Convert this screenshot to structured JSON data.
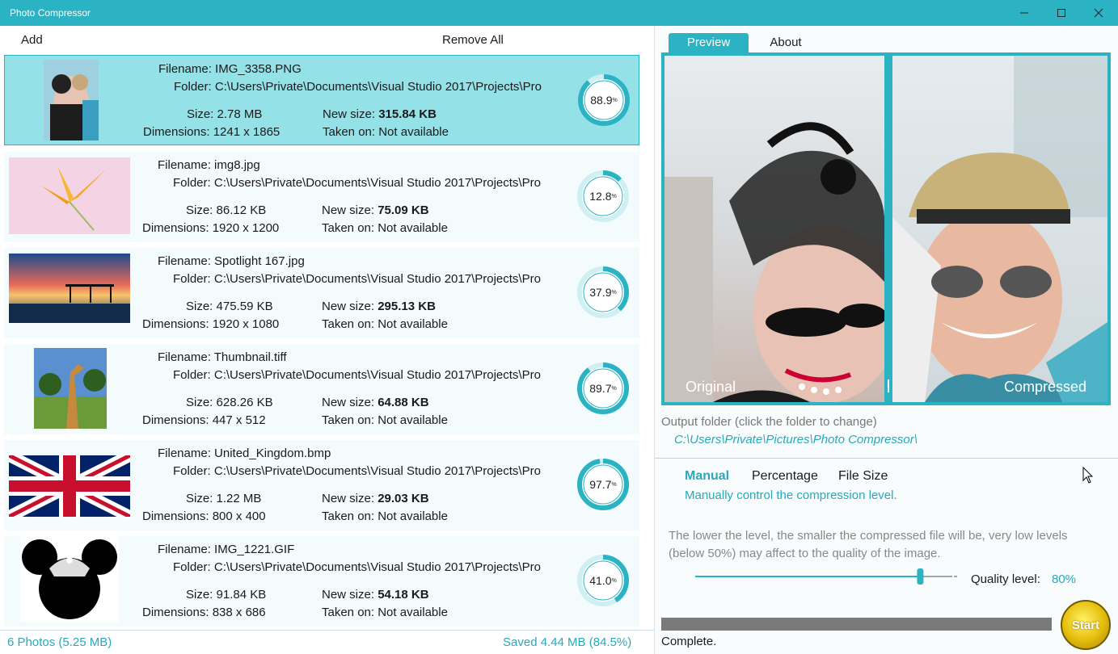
{
  "window": {
    "title": "Photo Compressor",
    "min_icon": "minimize-icon",
    "max_icon": "maximize-icon",
    "close_icon": "close-icon"
  },
  "toolbar": {
    "add": "Add",
    "remove_all": "Remove All"
  },
  "labels": {
    "filename": "Filename:",
    "folder": "Folder:",
    "size": "Size:",
    "new_size": "New size:",
    "dimensions": "Dimensions:",
    "taken_on": "Taken on:"
  },
  "photos": [
    {
      "filename": "IMG_3358.PNG",
      "folder": "C:\\Users\\Private\\Documents\\Visual Studio 2017\\Projects\\Pro",
      "size": "2.78 MB",
      "new_size": "315.84 KB",
      "dimensions": "1241 x 1865",
      "taken_on": "Not available",
      "ratio": "88.9",
      "ratio_value": 88.9
    },
    {
      "filename": "img8.jpg",
      "folder": "C:\\Users\\Private\\Documents\\Visual Studio 2017\\Projects\\Pro",
      "size": "86.12 KB",
      "new_size": "75.09 KB",
      "dimensions": "1920 x 1200",
      "taken_on": "Not available",
      "ratio": "12.8",
      "ratio_value": 12.8
    },
    {
      "filename": "Spotlight 167.jpg",
      "folder": "C:\\Users\\Private\\Documents\\Visual Studio 2017\\Projects\\Pro",
      "size": "475.59 KB",
      "new_size": "295.13 KB",
      "dimensions": "1920 x 1080",
      "taken_on": "Not available",
      "ratio": "37.9",
      "ratio_value": 37.9
    },
    {
      "filename": "Thumbnail.tiff",
      "folder": "C:\\Users\\Private\\Documents\\Visual Studio 2017\\Projects\\Pro",
      "size": "628.26 KB",
      "new_size": "64.88 KB",
      "dimensions": "447 x 512",
      "taken_on": "Not available",
      "ratio": "89.7",
      "ratio_value": 89.7
    },
    {
      "filename": "United_Kingdom.bmp",
      "folder": "C:\\Users\\Private\\Documents\\Visual Studio 2017\\Projects\\Pro",
      "size": "1.22 MB",
      "new_size": "29.03 KB",
      "dimensions": "800 x 400",
      "taken_on": "Not available",
      "ratio": "97.7",
      "ratio_value": 97.7
    },
    {
      "filename": "IMG_1221.GIF",
      "folder": "C:\\Users\\Private\\Documents\\Visual Studio 2017\\Projects\\Pro",
      "size": "91.84 KB",
      "new_size": "54.18 KB",
      "dimensions": "838 x 686",
      "taken_on": "Not available",
      "ratio": "41.0",
      "ratio_value": 41.0
    }
  ],
  "ring_pct_symbol": "%",
  "status": {
    "count": "6 Photos (5.25 MB)",
    "saved": "Saved 4.44 MB (84.5%)"
  },
  "tabs": {
    "preview": "Preview",
    "about": "About"
  },
  "preview": {
    "original": "Original",
    "compressed": "Compressed"
  },
  "output": {
    "label": "Output folder (click the folder to change)",
    "path": "C:\\Users\\Private\\Pictures\\Photo Compressor\\"
  },
  "modes": {
    "manual": "Manual",
    "percentage": "Percentage",
    "file_size": "File Size",
    "active": "Manual",
    "description": "Manually control the compression level."
  },
  "explanation": "The lower the level, the smaller the compressed file will be, very low levels (below 50%) may affect to the quality of the image.",
  "quality": {
    "label": "Quality level:",
    "value": "80%",
    "level": 0.8
  },
  "progress": {
    "fraction": 1.0,
    "status": "Complete."
  },
  "start": "Start",
  "colors": {
    "accent": "#2bb3c3",
    "selected_row": "#95e1e8",
    "start_button": "#e8c10f"
  }
}
